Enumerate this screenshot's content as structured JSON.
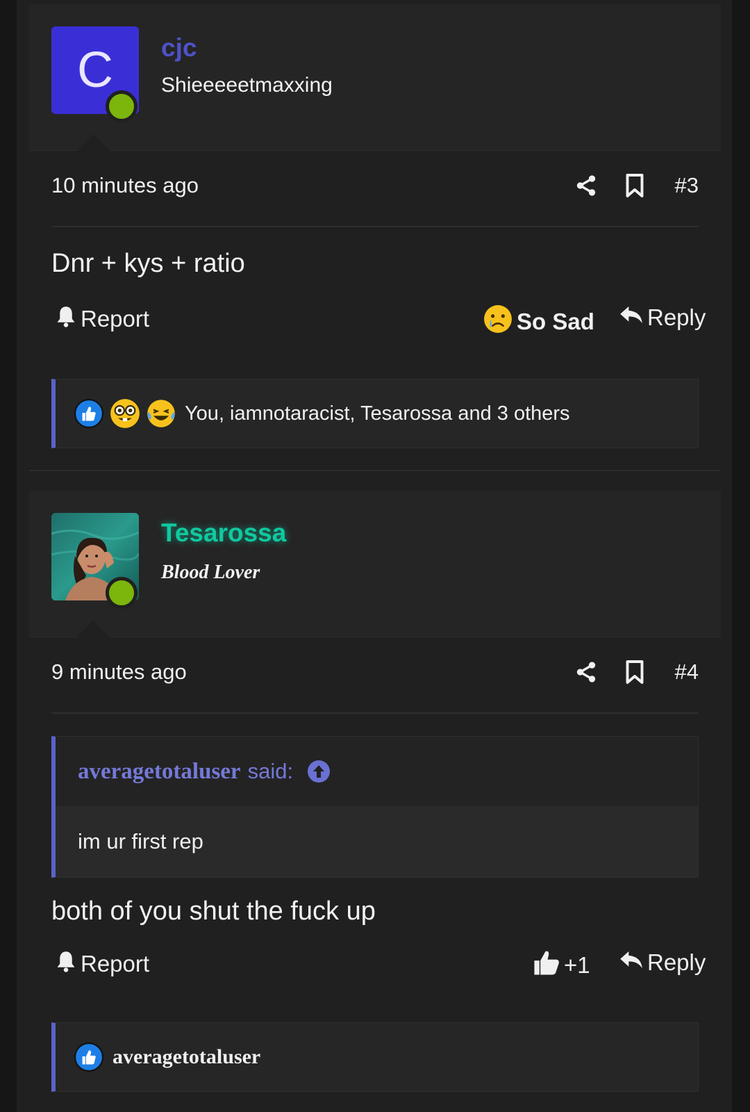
{
  "posts": [
    {
      "avatar_letter": "C",
      "username": "cjc",
      "username_color": "#4d52c9",
      "user_title": "Shieeeeetmaxxing",
      "time": "10 minutes ago",
      "post_number": "#3",
      "body": "Dnr + kys + ratio",
      "report_label": "Report",
      "reaction_label": "So Sad",
      "reaction_icon": "crying-face-emoji",
      "reply_label": "Reply",
      "reactions_summary": "You, iamnotaracist, Tesarossa and 3 others",
      "reaction_icons": [
        "thumbs-up-icon",
        "nerd-face-emoji",
        "laughing-tears-emoji"
      ]
    },
    {
      "username": "Tesarossa",
      "username_color": "#10c9a0",
      "user_title": "Blood Lover",
      "avatar_icon": "profile-photo",
      "time": "9 minutes ago",
      "post_number": "#4",
      "quote_author": "averagetotaluser",
      "quote_said": "said:",
      "quote_body": "im ur first rep",
      "body": "both of you shut the fuck up",
      "report_label": "Report",
      "like_label": "+1",
      "reply_label": "Reply",
      "reactions_summary": "averagetotaluser",
      "reaction_icons": [
        "thumbs-up-icon"
      ]
    }
  ],
  "colors": {
    "accent": "#5b62c9",
    "online": "#7cb50b",
    "background": "#202020"
  }
}
